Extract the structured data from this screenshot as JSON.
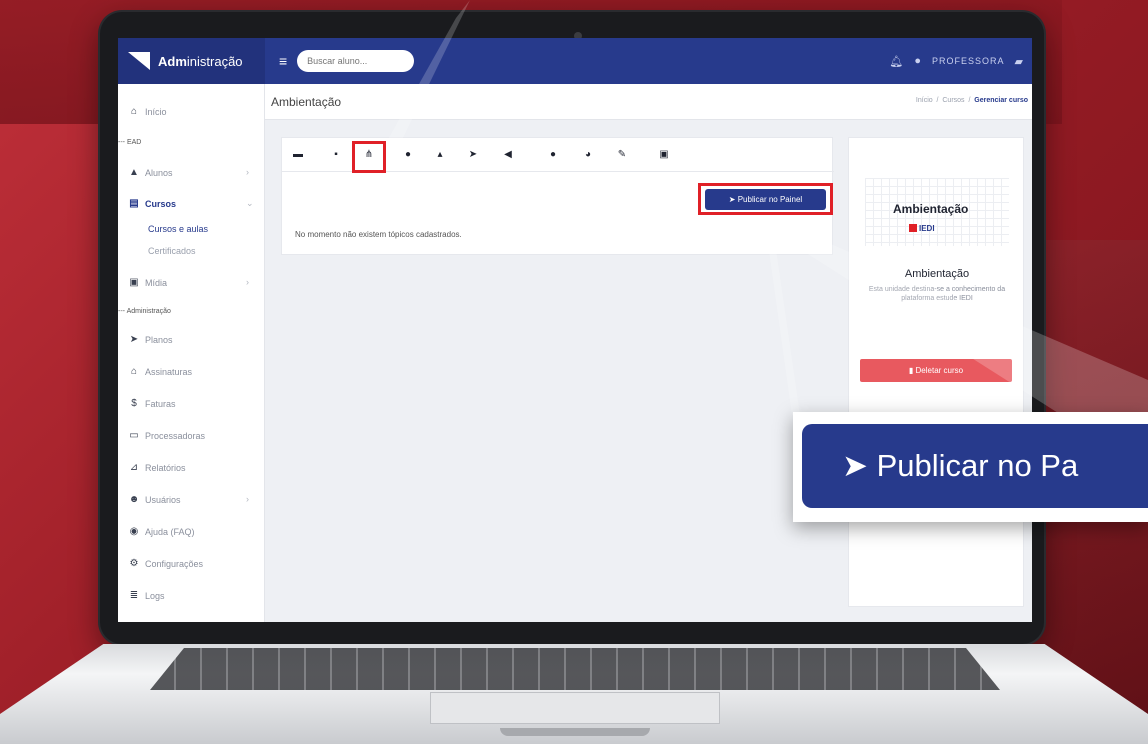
{
  "app": {
    "brand_bold": "Adm",
    "brand_rest": "inistração"
  },
  "topbar": {
    "search_placeholder": "Buscar aluno...",
    "user_label": "PROFESSORA"
  },
  "page": {
    "title": "Ambientação"
  },
  "breadcrumb": {
    "items": [
      "Início",
      "Cursos"
    ],
    "current": "Gerenciar curso",
    "separator": "/"
  },
  "sidebar": {
    "home": "Início",
    "section_ead": "EAD",
    "alunos": "Alunos",
    "cursos": "Cursos",
    "cursos_sub": [
      "Cursos e aulas",
      "Certificados"
    ],
    "midia": "Mídia",
    "section_admin": "Administração",
    "planos": "Planos",
    "assinaturas": "Assinaturas",
    "faturas": "Faturas",
    "processadoras": "Processadoras",
    "relatorios": "Relatórios",
    "usuarios": "Usuários",
    "ajuda": "Ajuda (FAQ)",
    "configuracoes": "Configurações",
    "logs": "Logs"
  },
  "toolbar_icons": [
    "book-icon",
    "calendar-icon",
    "sitemap-icon",
    "comment-icon",
    "bell-icon",
    "paper-plane-icon",
    "megaphone-icon",
    "circle-icon",
    "pie-chart-icon",
    "pencil-icon",
    "image-icon"
  ],
  "main": {
    "publish_button": "Publicar no Painel",
    "empty_message": "No momento não existem tópicos cadastrados."
  },
  "course_card": {
    "thumb_title": "Ambientação",
    "thumb_brand": "IEDI",
    "name": "Ambientação",
    "description": "Esta unidade destina-se a conhecimento da plataforma estude IEDI",
    "delete_button": "Deletar curso"
  },
  "zoom": {
    "label": "Publicar no Pa"
  },
  "colors": {
    "primary": "#273a8c",
    "highlight": "#e02027",
    "danger": "#e8595f",
    "background": "#b02630"
  }
}
